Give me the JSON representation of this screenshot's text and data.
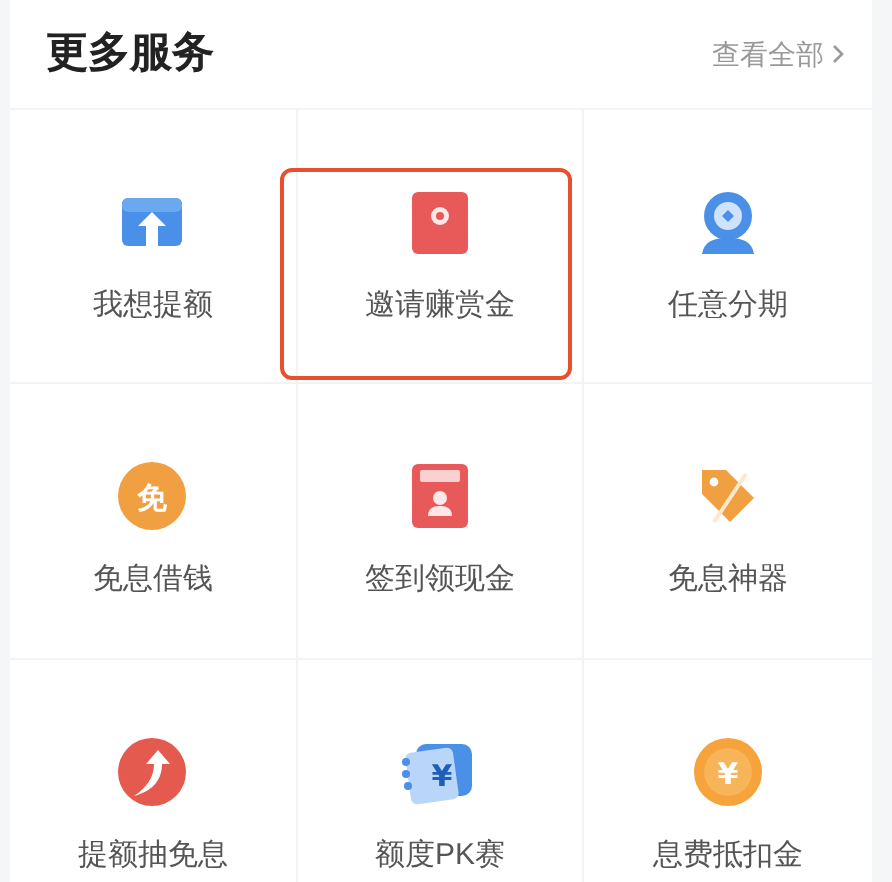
{
  "section": {
    "title": "更多服务",
    "link": "查看全部"
  },
  "services": [
    {
      "label": "我想提额",
      "highlighted": false
    },
    {
      "label": "邀请赚赏金",
      "highlighted": true
    },
    {
      "label": "任意分期",
      "highlighted": false
    },
    {
      "label": "免息借钱",
      "highlighted": false,
      "glyph": "免"
    },
    {
      "label": "签到领现金",
      "highlighted": false
    },
    {
      "label": "免息神器",
      "highlighted": false
    },
    {
      "label": "提额抽免息",
      "highlighted": false
    },
    {
      "label": "额度PK赛",
      "highlighted": false,
      "glyph": "¥"
    },
    {
      "label": "息费抵扣金",
      "highlighted": false,
      "glyph": "¥"
    }
  ]
}
